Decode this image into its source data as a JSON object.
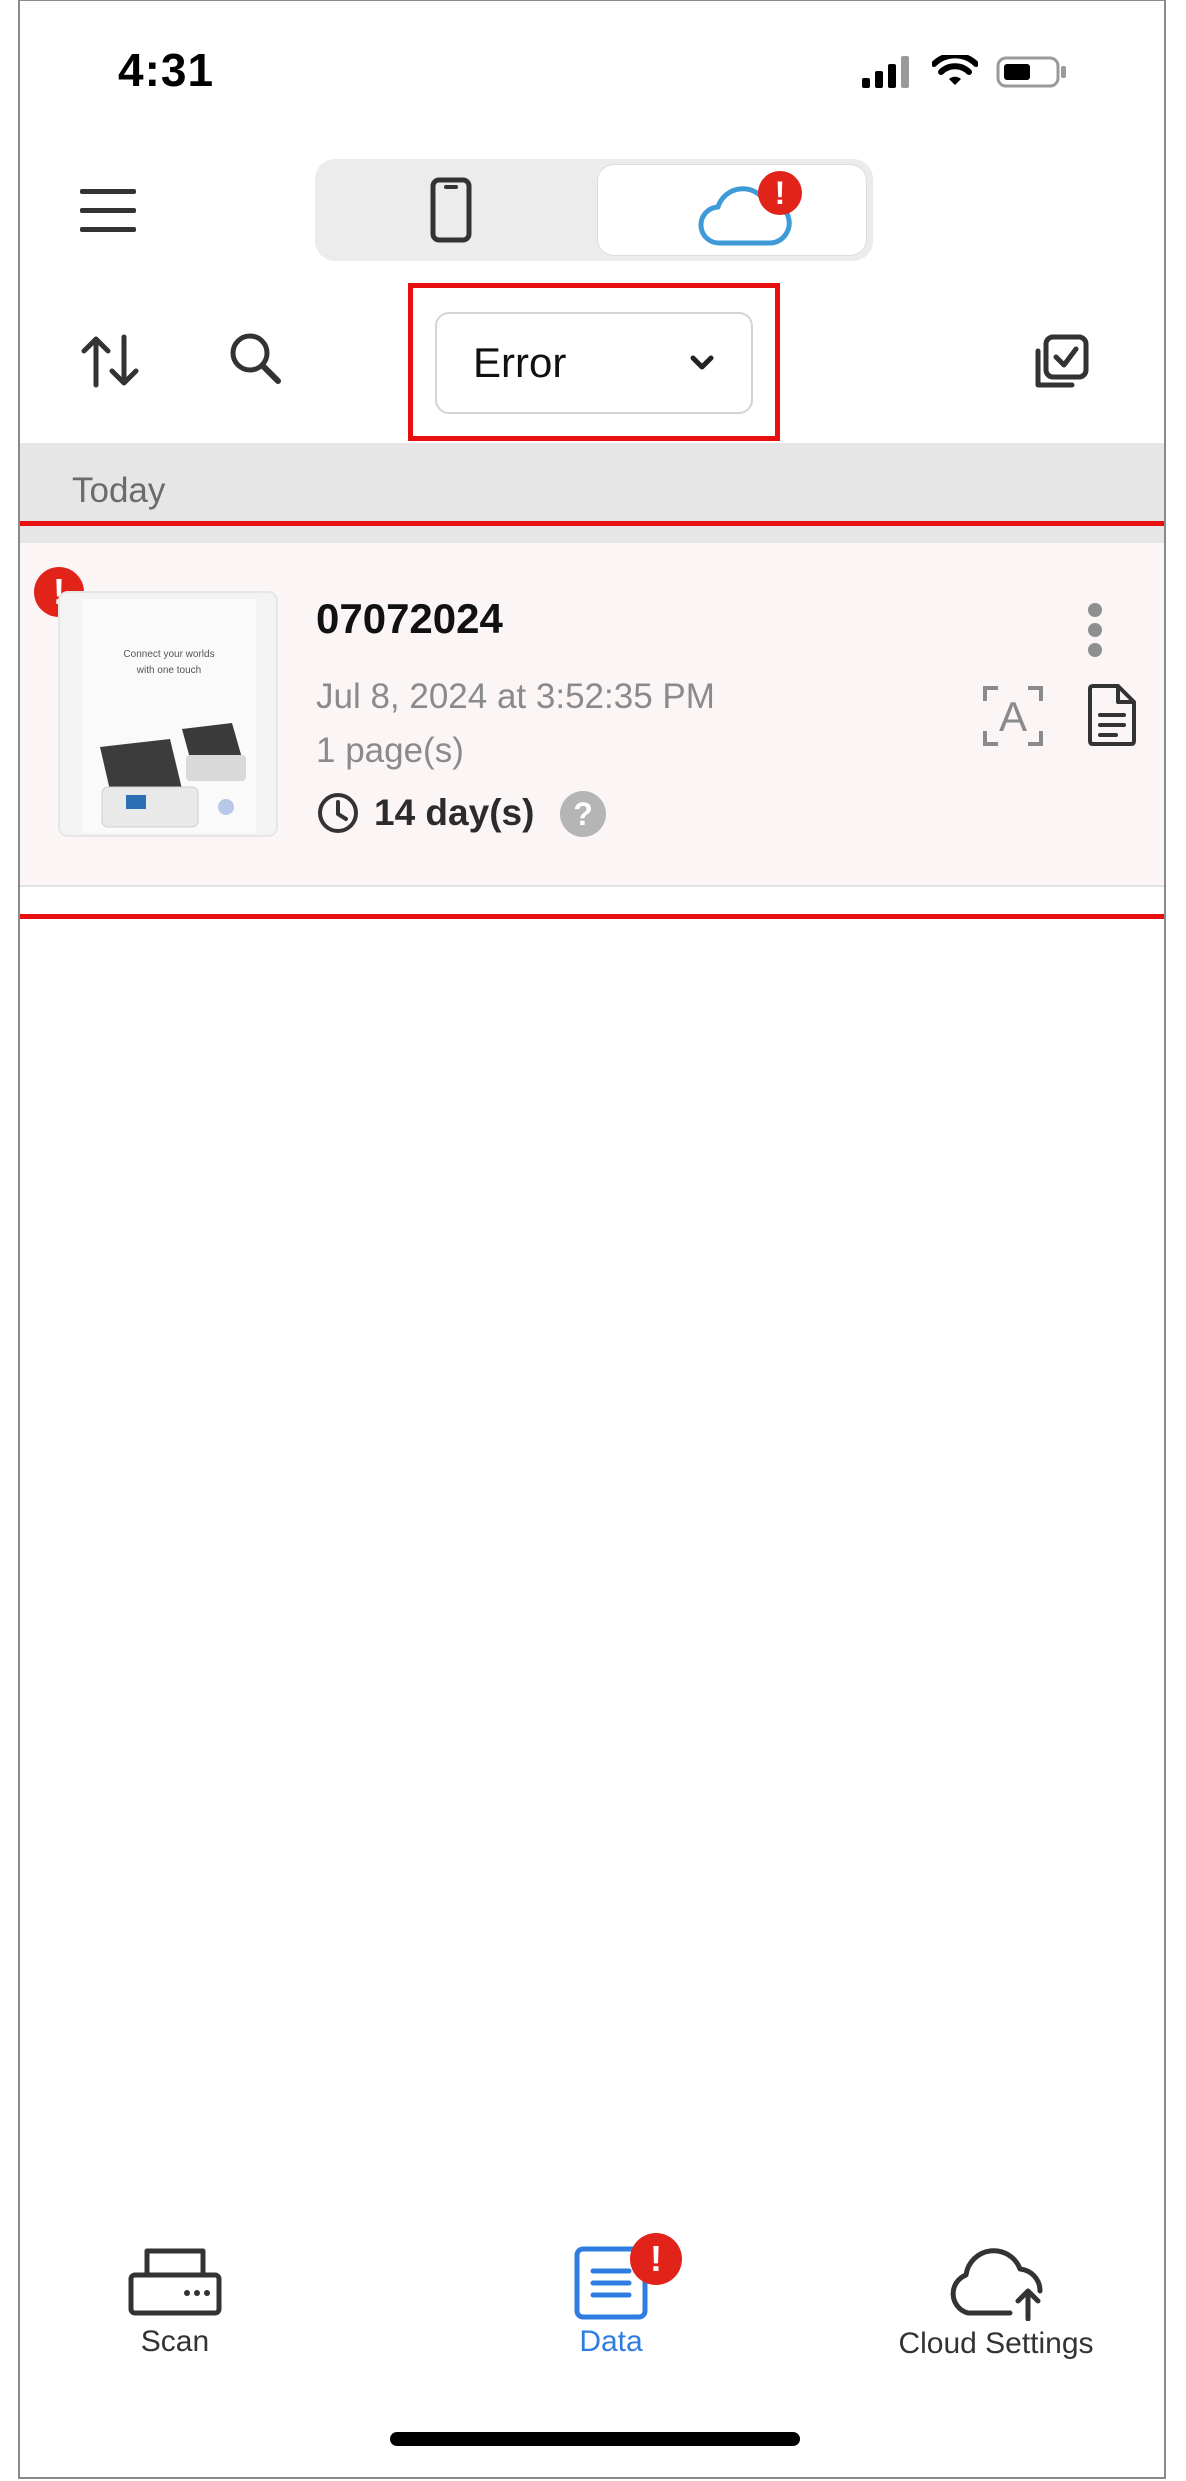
{
  "status_bar": {
    "time": "4:31"
  },
  "segmented": {
    "local_icon": "phone-icon",
    "cloud_icon": "cloud-icon",
    "cloud_badge": "!"
  },
  "toolbar": {
    "filter_value": "Error"
  },
  "section": {
    "header": "Today"
  },
  "documents": [
    {
      "title": "07072024",
      "date": "Jul 8, 2024 at 3:52:35 PM",
      "pages": "1 page(s)",
      "retention": "14 day(s)",
      "error_badge": "!",
      "help_mark": "?",
      "ocr_mark": "A",
      "thumb_text_1": "Connect your worlds",
      "thumb_text_2": "with one touch"
    }
  ],
  "tabbar": {
    "scan_label": "Scan",
    "data_label": "Data",
    "data_badge": "!",
    "cloud_label": "Cloud Settings",
    "active_color": "#2f7de1"
  },
  "colors": {
    "error": "#e2231a",
    "highlight": "#e8100f",
    "row_bg": "#fcf5f5"
  }
}
